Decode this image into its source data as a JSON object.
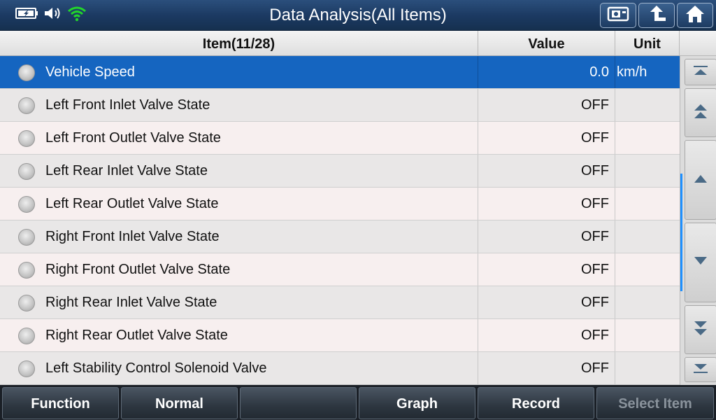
{
  "app": {
    "title": "Data Analysis(All Items)"
  },
  "status_icons": [
    "battery-charging-icon",
    "speaker-icon",
    "wifi-icon"
  ],
  "toolbar_buttons": [
    "screenshot-icon",
    "back-icon",
    "home-icon"
  ],
  "table": {
    "headers": {
      "item": "Item(11/28)",
      "value": "Value",
      "unit": "Unit"
    },
    "rows": [
      {
        "label": "Vehicle Speed",
        "value": "0.0",
        "unit": "km/h",
        "selected": true
      },
      {
        "label": "Left Front Inlet Valve State",
        "value": "OFF",
        "unit": ""
      },
      {
        "label": "Left Front Outlet Valve State",
        "value": "OFF",
        "unit": ""
      },
      {
        "label": "Left Rear Inlet Valve State",
        "value": "OFF",
        "unit": ""
      },
      {
        "label": "Left Rear Outlet Valve State",
        "value": "OFF",
        "unit": ""
      },
      {
        "label": "Right Front Inlet Valve State",
        "value": "OFF",
        "unit": ""
      },
      {
        "label": "Right Front Outlet Valve State",
        "value": "OFF",
        "unit": ""
      },
      {
        "label": "Right Rear Inlet Valve State",
        "value": "OFF",
        "unit": ""
      },
      {
        "label": "Right Rear Outlet Valve State",
        "value": "OFF",
        "unit": ""
      },
      {
        "label": "Left Stability Control Solenoid Valve",
        "value": "OFF",
        "unit": ""
      }
    ]
  },
  "scroll_buttons": [
    "scroll-top-icon",
    "page-up-icon",
    "line-up-icon",
    "line-down-icon",
    "page-down-icon",
    "scroll-bottom-icon"
  ],
  "bottom_bar": {
    "function": "Function",
    "normal": "Normal",
    "blank": "",
    "graph": "Graph",
    "record": "Record",
    "select_item": "Select Item"
  },
  "colors": {
    "selected_row": "#1565c0",
    "title_bar": "#1c3a63",
    "scroll_indicator": "#1e90ff",
    "wifi": "#22d62a"
  }
}
